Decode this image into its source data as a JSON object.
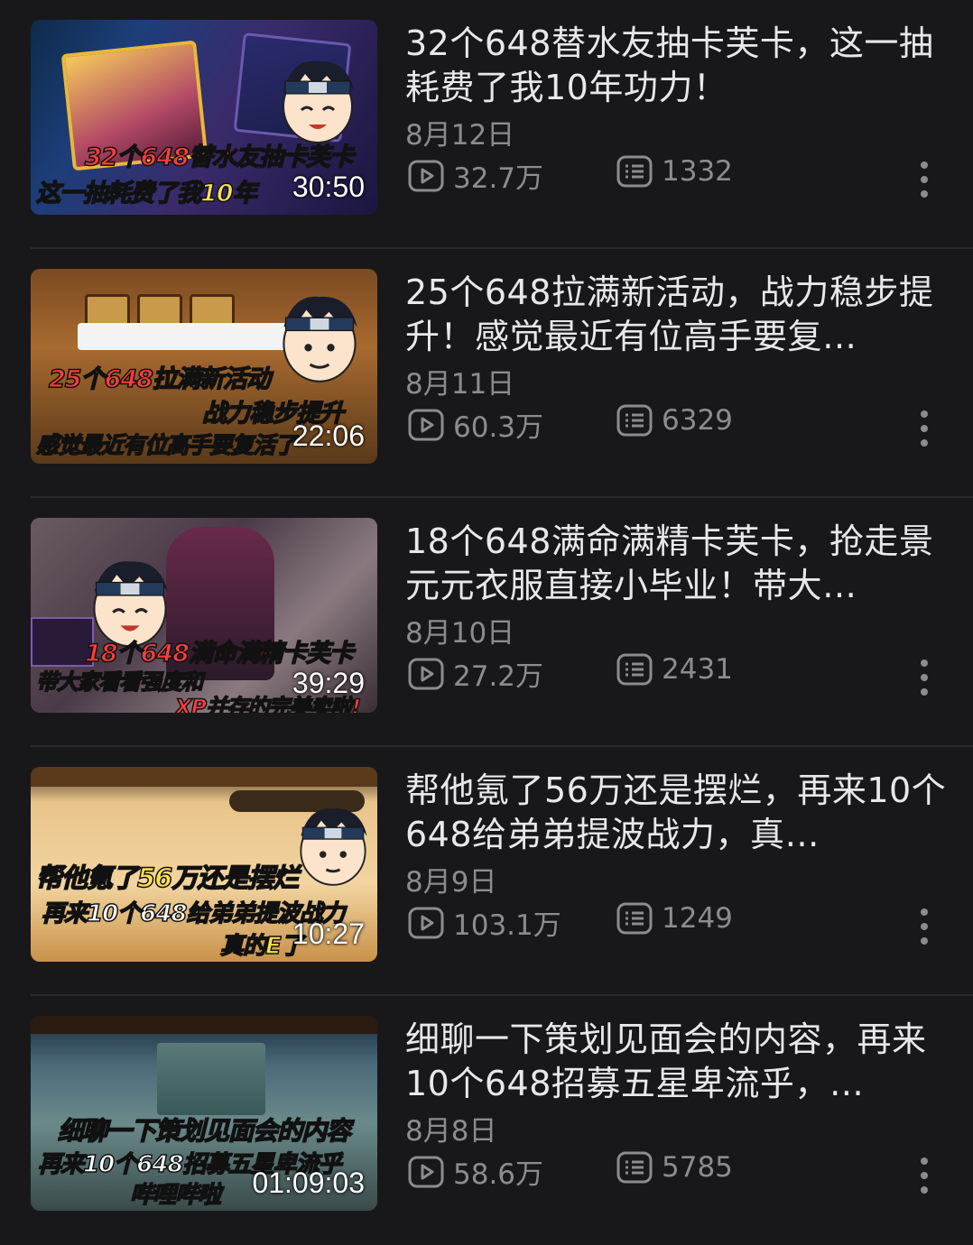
{
  "videos": [
    {
      "title": "32个648替水友抽卡芙卡，这一抽耗费了我10年功力！",
      "date": "8月12日",
      "views": "32.7万",
      "comments": "1332",
      "duration": "30:50",
      "thumb_caption_1": "32个648替水友抽卡芙卡",
      "thumb_caption_2": "这一抽耗费了我10年"
    },
    {
      "title": "25个648拉满新活动，战力稳步提升！感觉最近有位高手要复…",
      "date": "8月11日",
      "views": "60.3万",
      "comments": "6329",
      "duration": "22:06",
      "thumb_caption_1": "25个648拉满新活动",
      "thumb_caption_2": "战力稳步提升",
      "thumb_caption_3": "感觉最近有位高手要复活了"
    },
    {
      "title": "18个648满命满精卡芙卡，抢走景元元衣服直接小毕业！带大…",
      "date": "8月10日",
      "views": "27.2万",
      "comments": "2431",
      "duration": "39:29",
      "thumb_caption_1": "18个648满命满精卡芙卡",
      "thumb_caption_2": "带大家看看强度和",
      "thumb_caption_3": "XP并存的完美卖啦!"
    },
    {
      "title": "帮他氪了56万还是摆烂，再来10个648给弟弟提波战力，真…",
      "date": "8月9日",
      "views": "103.1万",
      "comments": "1249",
      "duration": "10:27",
      "thumb_caption_1": "帮他氪了56万还是摆烂",
      "thumb_caption_2": "再来10个648给弟弟提波战力",
      "thumb_caption_3": "真的E了"
    },
    {
      "title": "细聊一下策划见面会的内容，再来10个648招募五星卑流乎，…",
      "date": "8月8日",
      "views": "58.6万",
      "comments": "5785",
      "duration": "01:09:03",
      "thumb_caption_1": "细聊一下策划见面会的内容",
      "thumb_caption_2": "再来10个648招募五星卑流乎",
      "thumb_caption_3": "哔哩哔啦"
    }
  ]
}
